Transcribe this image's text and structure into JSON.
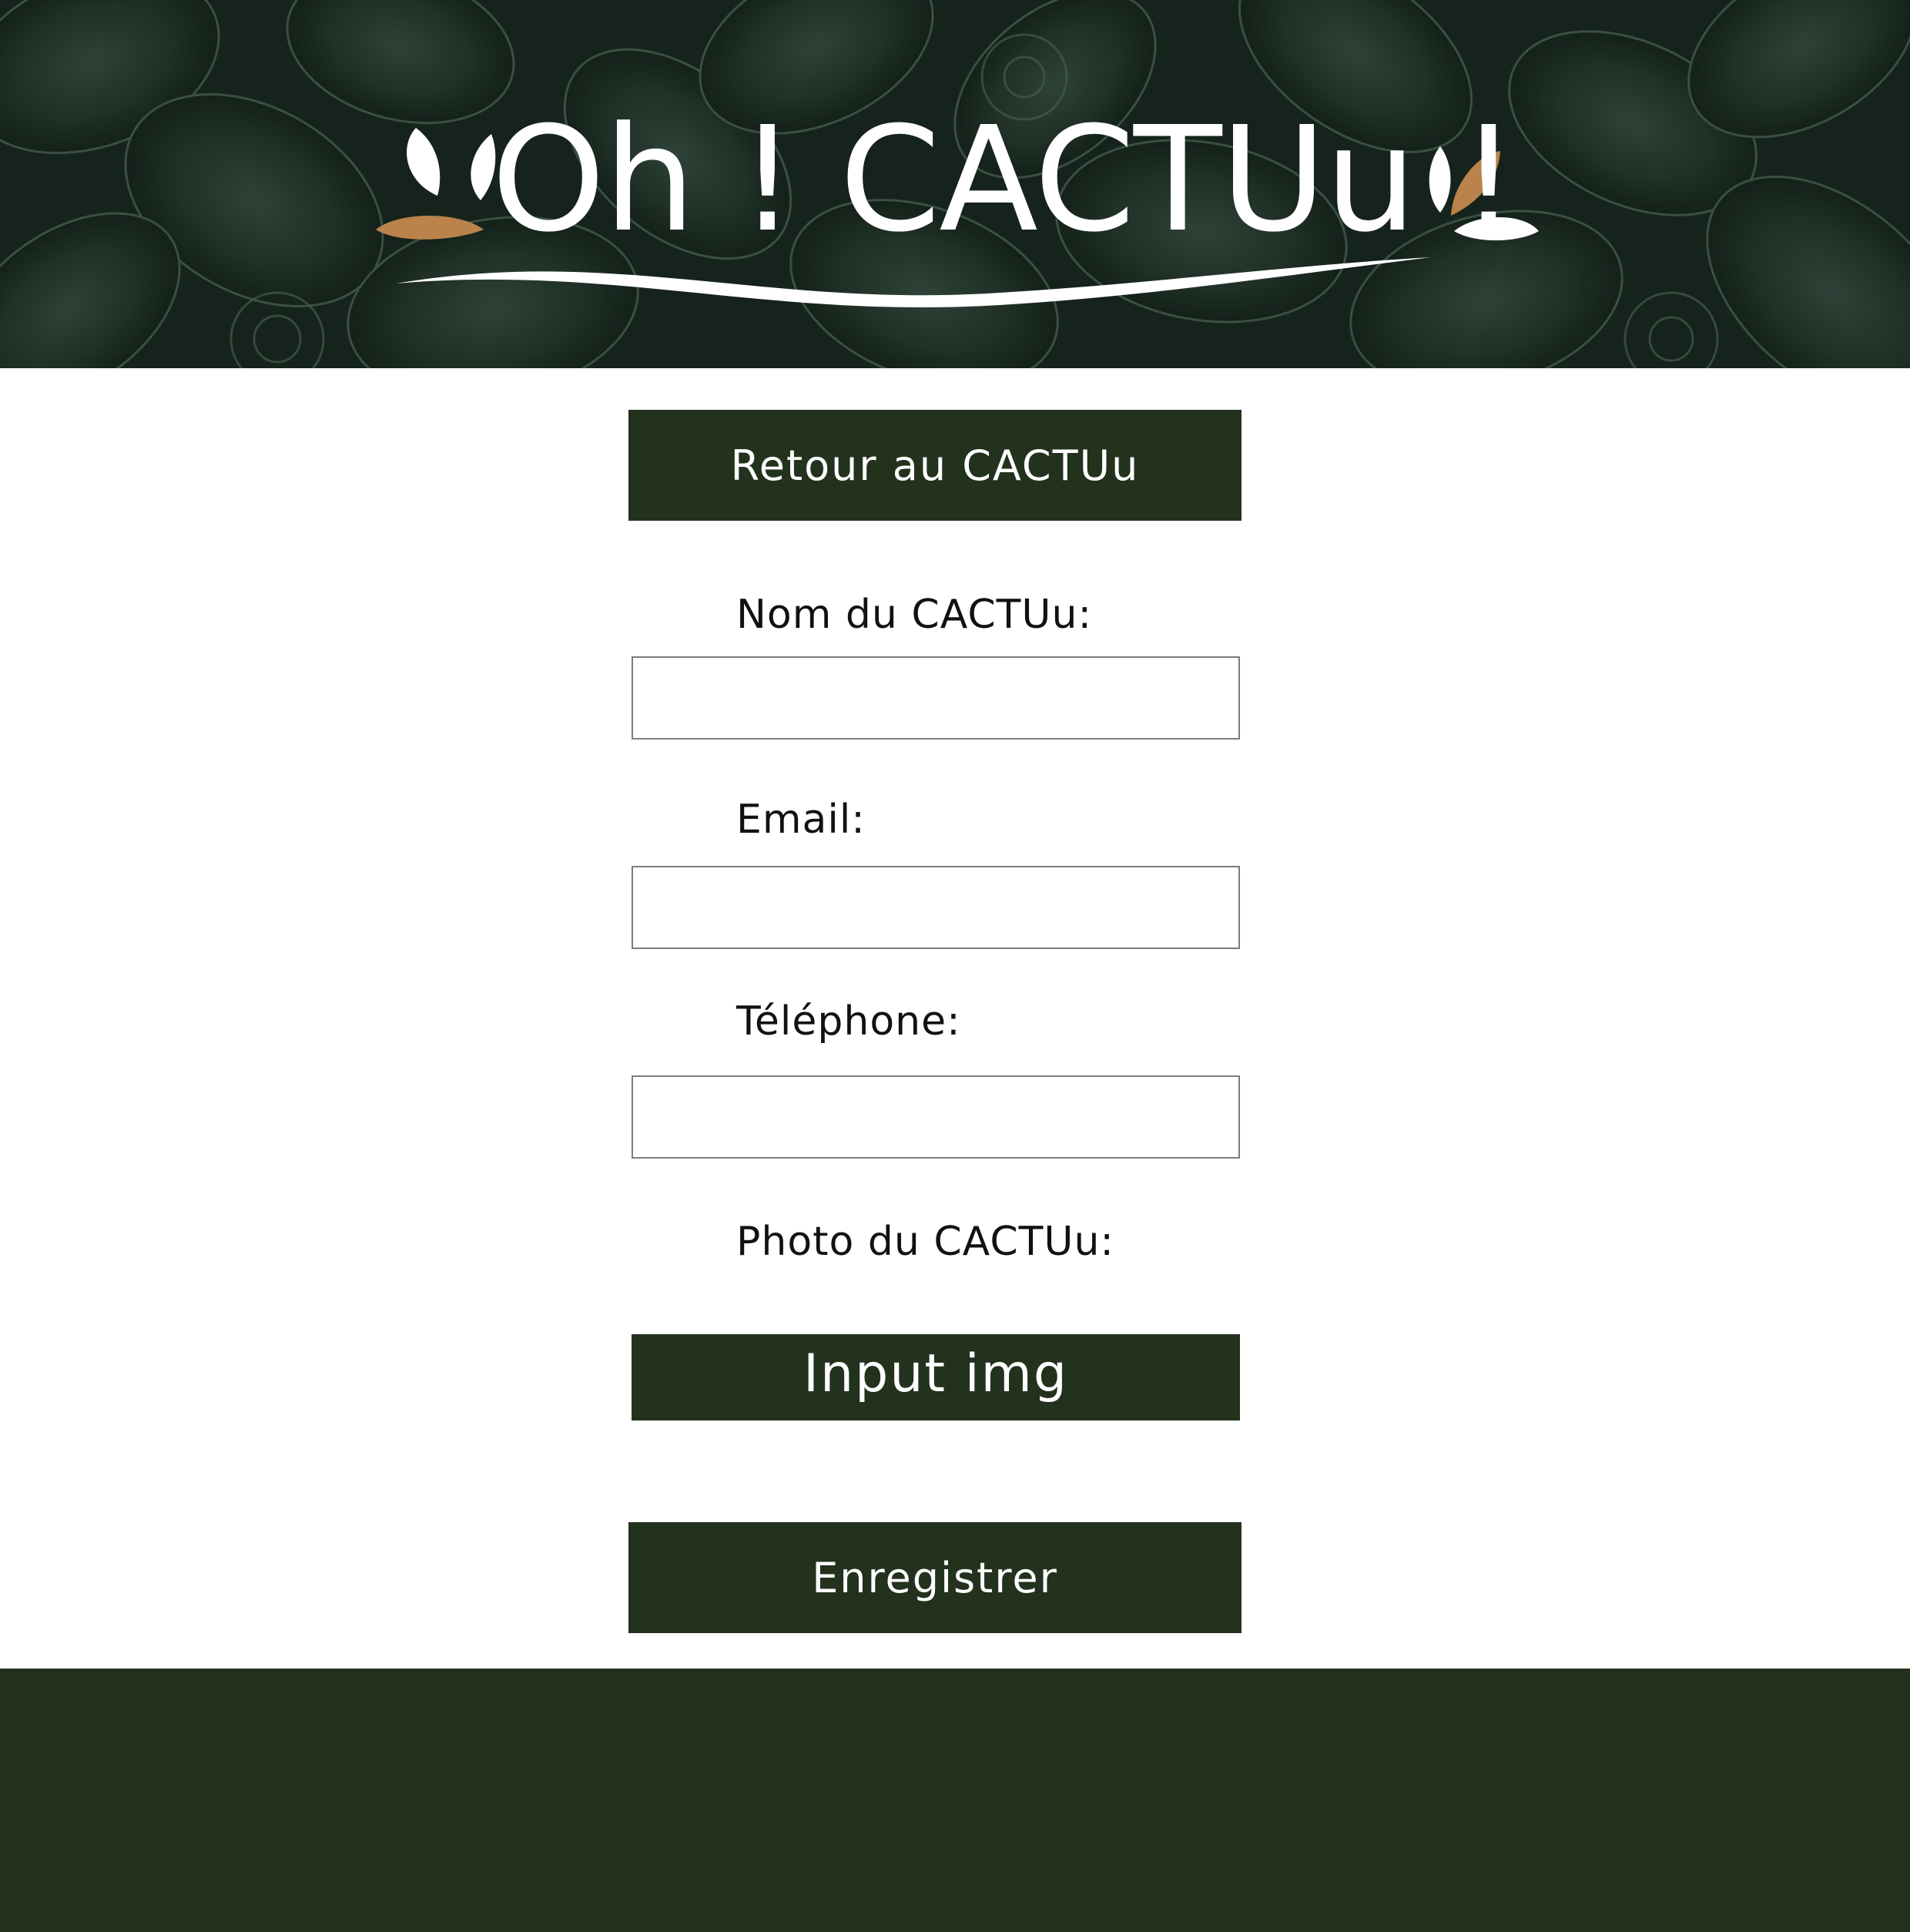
{
  "header": {
    "logo_text": "Oh ! CACTUu !"
  },
  "form": {
    "back_button_label": "Retour au CACTUu",
    "name_label": "Nom du CACTUu:",
    "name_value": "",
    "email_label": "Email:",
    "email_value": "",
    "phone_label": "Téléphone:",
    "phone_value": "",
    "photo_label": "Photo du CACTUu:",
    "photo_button_label": "Input img",
    "submit_label": "Enregistrer"
  },
  "colors": {
    "primary": "#23321d",
    "banner_background": "#1b2c25",
    "logo_accent": "#b9834b",
    "text": "#111111",
    "field_border": "#7d7d7d"
  },
  "icons": {
    "logo_left": "leaf-drop-icon",
    "logo_right": "leaf-drop-icon"
  }
}
